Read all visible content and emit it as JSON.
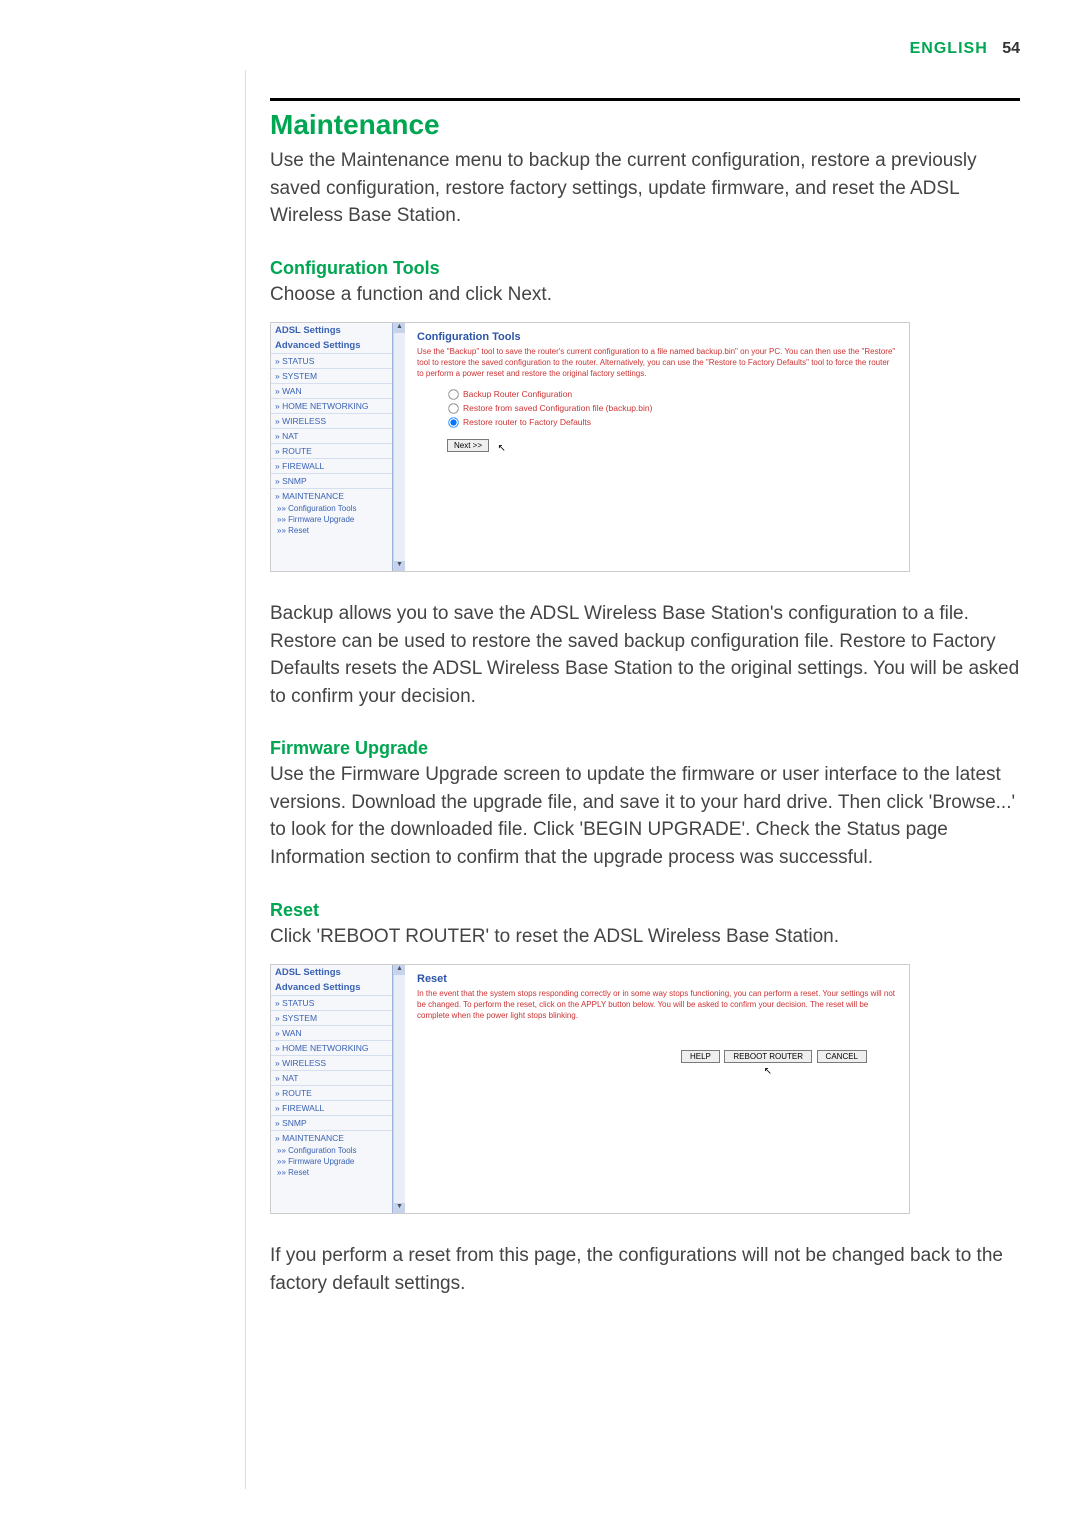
{
  "header": {
    "lang": "ENGLISH",
    "page_number": "54"
  },
  "maintenance": {
    "heading": "Maintenance",
    "intro": "Use the Maintenance menu to backup the current configuration, restore a previously saved configuration, restore factory settings, update firmware, and reset the ADSL Wireless Base Station."
  },
  "config_tools": {
    "heading": "Configuration Tools",
    "intro": "Choose a function and click Next.",
    "body_after": "Backup allows you to save the ADSL Wireless Base Station's configuration to a file. Restore can be used to restore the saved backup configuration file. Restore to Factory Defaults resets the ADSL Wireless Base Station to the original settings. You will be asked to confirm your decision."
  },
  "firmware": {
    "heading": "Firmware Upgrade",
    "body": "Use the Firmware Upgrade screen to update the firmware or user interface to the latest versions. Download the upgrade file, and save it to your hard drive. Then click 'Browse...' to look for the downloaded file. Click 'BEGIN UPGRADE'. Check the Status page Information section to confirm that the upgrade process was successful."
  },
  "reset": {
    "heading": "Reset",
    "intro": "Click 'REBOOT ROUTER' to reset the ADSL Wireless Base Station.",
    "body_after": "If you perform a reset from this page, the configurations will not be changed back to the factory default settings."
  },
  "sidebar_common": {
    "adsl": "ADSL Settings",
    "advanced": "Advanced Settings",
    "items": [
      "» STATUS",
      "» SYSTEM",
      "» WAN",
      "» HOME NETWORKING",
      "» WIRELESS",
      "» NAT",
      "» ROUTE",
      "» FIREWALL",
      "» SNMP",
      "» MAINTENANCE"
    ],
    "sub": [
      "»» Configuration Tools",
      "»» Firmware Upgrade",
      "»» Reset"
    ]
  },
  "shot1": {
    "title": "Configuration Tools",
    "desc": "Use the \"Backup\" tool to save the router's current configuration to a file named backup.bin\" on your PC. You can then use the \"Restore\" tool to restore the saved configuration to the router. Alternatively, you can use the \"Restore to Factory Defaults\" tool to force the router to perform a power reset and restore the original factory settings.",
    "opt1": "Backup Router Configuration",
    "opt2": "Restore from saved Configuration file (backup.bin)",
    "opt3": "Restore router to Factory Defaults",
    "next": "Next >>"
  },
  "shot2": {
    "title": "Reset",
    "desc": "In the event that the system stops responding correctly or in some way stops functioning, you can perform a reset. Your settings will not be changed. To perform the reset, click on the APPLY button below. You will be asked to confirm your decision. The reset will be complete when the power light stops blinking.",
    "btn_help": "HELP",
    "btn_reboot": "REBOOT ROUTER",
    "btn_cancel": "CANCEL"
  }
}
